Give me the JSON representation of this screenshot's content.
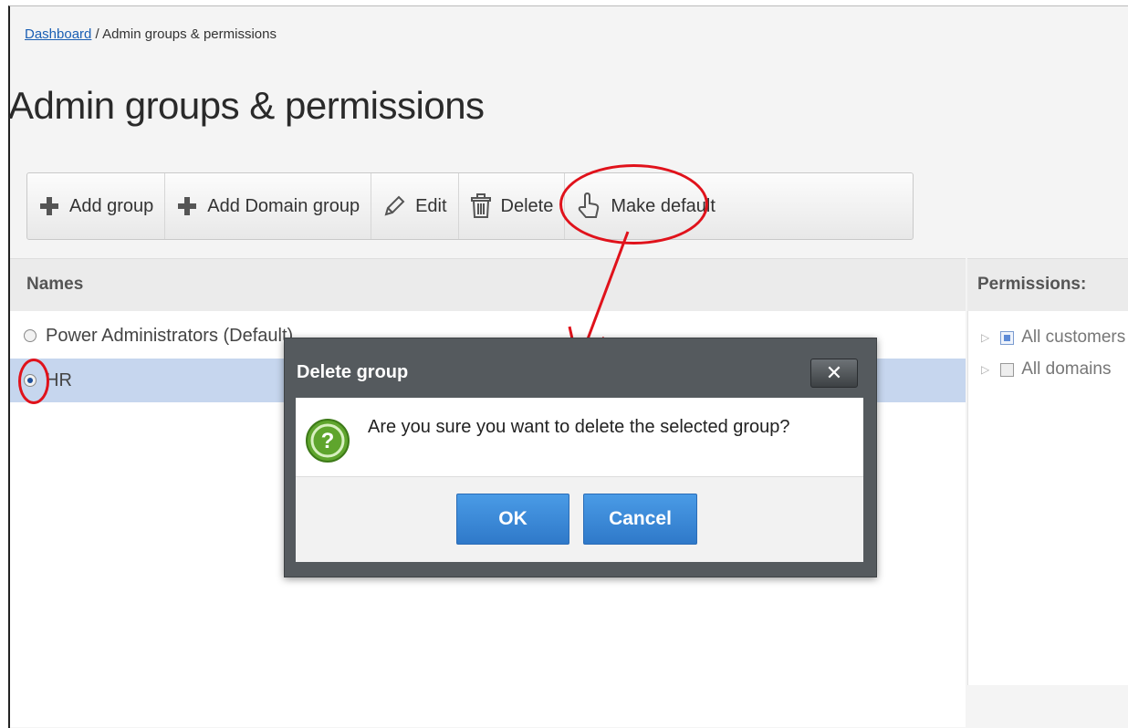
{
  "breadcrumb": {
    "home": "Dashboard",
    "separator": " / ",
    "current": "Admin groups & permissions"
  },
  "page_title": "Admin groups & permissions",
  "toolbar": {
    "add_group": "Add group",
    "add_domain_group": "Add Domain group",
    "edit": "Edit",
    "delete": "Delete",
    "make_default": "Make default"
  },
  "names": {
    "header": "Names",
    "rows": [
      {
        "label": "Power Administrators (Default)",
        "selected": false
      },
      {
        "label": "HR",
        "selected": true
      }
    ]
  },
  "permissions": {
    "header": "Permissions:",
    "items": [
      {
        "label": "All customers"
      },
      {
        "label": "All domains"
      }
    ]
  },
  "dialog": {
    "title": "Delete group",
    "close": "✕",
    "message": "Are you sure you want to delete the selected group?",
    "ok": "OK",
    "cancel": "Cancel"
  },
  "colors": {
    "annotation": "#e0121b",
    "accent": "#2f79c9",
    "selection": "#c6d6ee"
  }
}
